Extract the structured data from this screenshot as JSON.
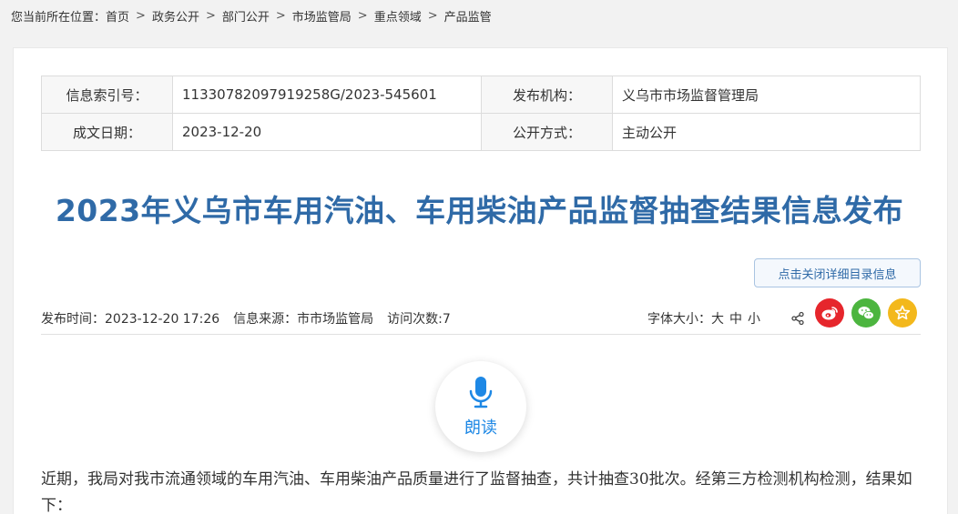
{
  "breadcrumb": {
    "prefix": "您当前所在位置：",
    "items": [
      "首页",
      "政务公开",
      "部门公开",
      "市场监管局",
      "重点领域",
      "产品监管"
    ],
    "separator": ">"
  },
  "meta": {
    "index_label": "信息索引号：",
    "index_value": "11330782097919258G/2023-545601",
    "publisher_label": "发布机构：",
    "publisher_value": "义乌市市场监督管理局",
    "date_label": "成文日期：",
    "date_value": "2023-12-20",
    "disclosure_label": "公开方式：",
    "disclosure_value": "主动公开"
  },
  "article": {
    "title": "2023年义乌市车用汽油、车用柴油产品监督抽查结果信息发布",
    "toggle_label": "点击关闭详细目录信息",
    "publish_time": "发布时间：2023-12-20 17:26",
    "source": "信息来源：市市场监管局",
    "visits": "访问次数:7",
    "fontsize_label": "字体大小：",
    "fontsize_large": "大",
    "fontsize_medium": "中",
    "fontsize_small": "小",
    "listen_label": "朗读",
    "paragraph": "近期，我局对我市流通领域的车用汽油、车用柴油产品质量进行了监督抽查，共计抽查30批次。经第三方检测机构检测，结果如下："
  },
  "icons": {
    "share": "share-icon",
    "weibo": "weibo-icon",
    "wechat": "wechat-icon",
    "favorite": "star-icon",
    "microphone": "microphone-icon"
  },
  "colors": {
    "title": "#2f6aa7",
    "weibo": "#e6262c",
    "wechat": "#4cb53f",
    "favorite": "#f3b81c",
    "listen": "#1e88e5"
  }
}
